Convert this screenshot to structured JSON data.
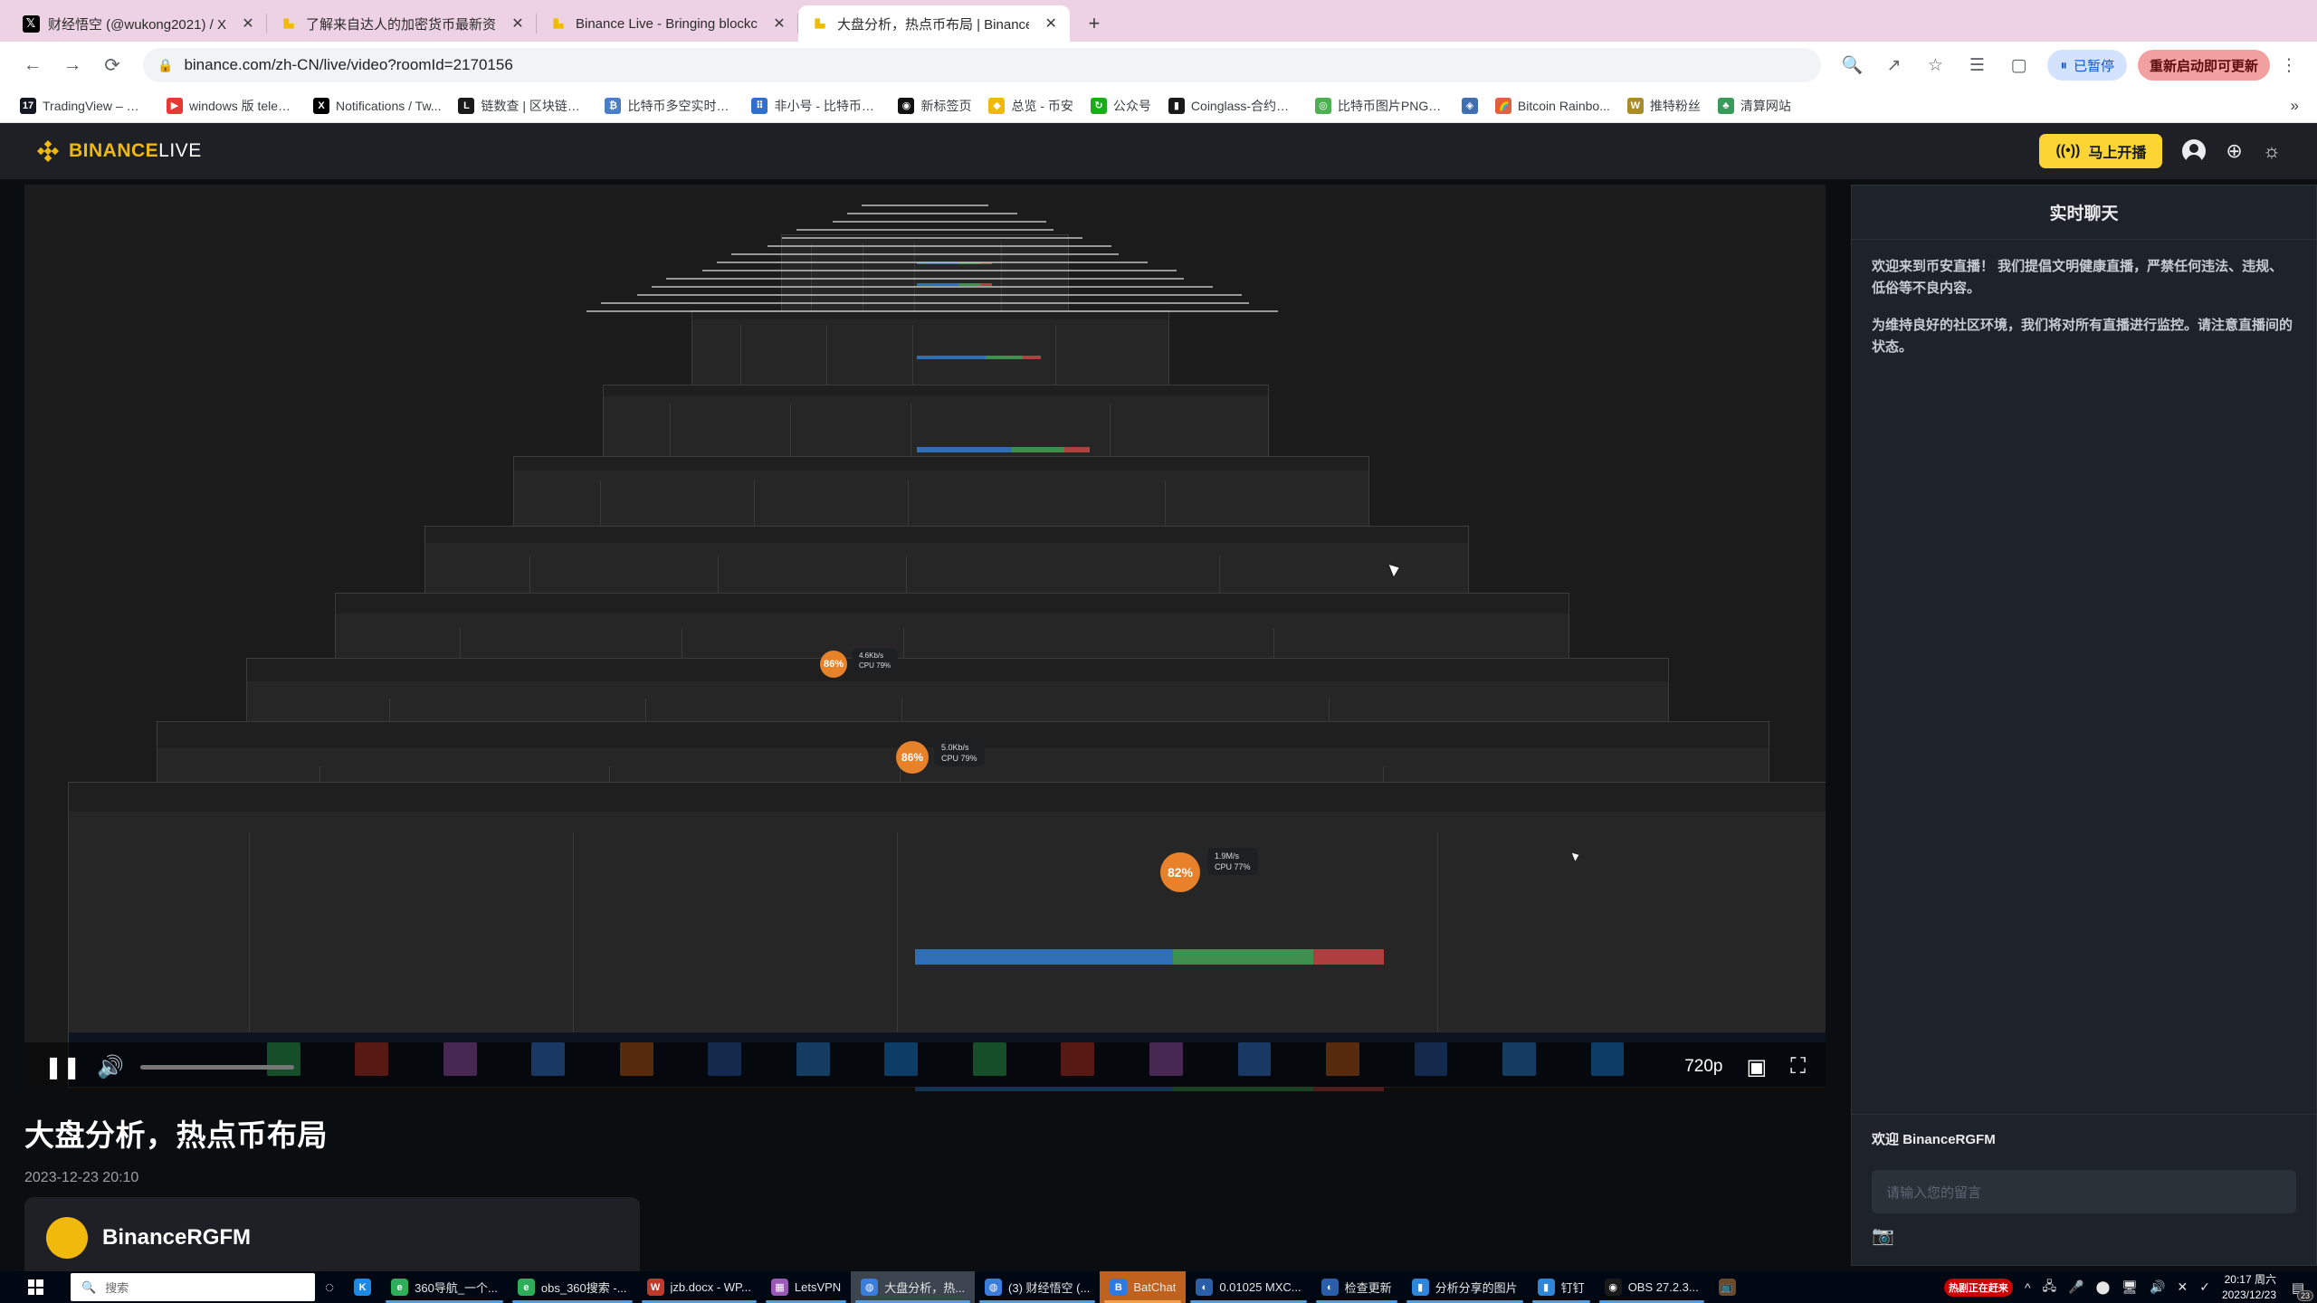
{
  "browser": {
    "tabs": [
      {
        "favicon": "x-logo-icon",
        "label": "财经悟空 (@wukong2021) / X",
        "close": "✕",
        "active": false
      },
      {
        "favicon": "binance-icon",
        "label": "了解来自达人的加密货币最新资",
        "close": "✕",
        "active": false
      },
      {
        "favicon": "binance-icon",
        "label": "Binance Live - Bringing blockc",
        "close": "✕",
        "active": false
      },
      {
        "favicon": "binance-icon",
        "label": "大盘分析，热点币布局 | Binance",
        "close": "✕",
        "active": true
      }
    ],
    "new_tab_label": "+",
    "nav": {
      "back": "←",
      "forward": "→",
      "reload": "⟳",
      "lock_icon": "lock-icon",
      "url": "binance.com/zh-CN/live/video?roomId=2170156",
      "zoom_icon": "🔍",
      "share_icon": "↗",
      "star_icon": "☆",
      "lists_icon": "☰",
      "sidepanel_icon": "▢",
      "paused_label": "已暂停",
      "update_label": "重新启动即可更新",
      "menu": "⋮"
    },
    "bookmarks": [
      {
        "icon_color": "#131722",
        "glyph": "17",
        "label": "TradingView – 追..."
      },
      {
        "icon_color": "#e53935",
        "glyph": "▶",
        "label": "windows 版 telegr..."
      },
      {
        "icon_color": "#000000",
        "glyph": "X",
        "label": "Notifications / Tw..."
      },
      {
        "icon_color": "#1a1a1a",
        "glyph": "L",
        "label": "链数查 | 区块链数..."
      },
      {
        "icon_color": "#4a7fc1",
        "glyph": "₿",
        "label": "比特币多空实时网..."
      },
      {
        "icon_color": "#2f6fd0",
        "glyph": "⠿",
        "label": "非小号 - 比特币行..."
      },
      {
        "icon_color": "#111111",
        "glyph": "◉",
        "label": "新标签页"
      },
      {
        "icon_color": "#f0b90b",
        "glyph": "◆",
        "label": "总览 - 币安"
      },
      {
        "icon_color": "#1aad19",
        "glyph": "↻",
        "label": "公众号"
      },
      {
        "icon_color": "#1a1a1a",
        "glyph": "▮",
        "label": "Coinglass-合约数..."
      },
      {
        "icon_color": "#4caf50",
        "glyph": "◎",
        "label": "比特币图片PNG去..."
      },
      {
        "icon_color": "#3f6fb0",
        "glyph": "◈",
        "label": ""
      },
      {
        "icon_color": "#e06040",
        "glyph": "🌈",
        "label": "Bitcoin Rainbo..."
      },
      {
        "icon_color": "#a98b2a",
        "glyph": "W",
        "label": "推特粉丝"
      },
      {
        "icon_color": "#3a9a5a",
        "glyph": "♣",
        "label": "清算网站"
      }
    ],
    "bookmarks_overflow": "»"
  },
  "site": {
    "logo_text_primary": "BINANCE",
    "logo_text_secondary": "LIVE",
    "go_live_label": "马上开播",
    "go_live_icon": "broadcast-icon",
    "account_icon": "account-icon",
    "grid_icon": "apps-grid-icon",
    "theme_icon": "brightness-icon"
  },
  "player": {
    "pause_icon": "pause-icon",
    "volume_icon": "volume-icon",
    "quality_label": "720p",
    "pip_icon": "picture-in-picture-icon",
    "fullscreen_icon": "fullscreen-icon",
    "overlays": [
      {
        "pct": "86%",
        "rate": "4.6Kb/s",
        "cpu": "CPU 79%"
      },
      {
        "pct": "86%",
        "rate": "5.0Kb/s",
        "cpu": "CPU 79%"
      },
      {
        "pct": "82%",
        "rate": "1.9M/s",
        "cpu": "CPU 77%"
      }
    ]
  },
  "video": {
    "title": "大盘分析，热点币布局",
    "date": "2023-12-23 20:10",
    "streamer_name": "BinanceRGFM"
  },
  "chat": {
    "header": "实时聊天",
    "system_messages": [
      "欢迎来到币安直播！ 我们提倡文明健康直播，严禁任何违法、违规、低俗等不良内容。",
      "为维持良好的社区环境，我们将对所有直播进行监控。请注意直播间的状态。"
    ],
    "welcome_prefix": "欢迎",
    "welcome_user": "BinanceRGFM",
    "input_placeholder": "请输入您的留言",
    "camera_icon": "camera-icon"
  },
  "taskbar": {
    "start_icon": "windows-start-icon",
    "search_icon": "search-icon",
    "search_placeholder": "搜索",
    "cortana_icon": "cortana-icon",
    "items": [
      {
        "icon_color": "#1e88e5",
        "glyph": "K",
        "label": "",
        "running": false,
        "state": "plain"
      },
      {
        "icon_color": "#2fae5a",
        "glyph": "e",
        "label": "360导航_一个...",
        "running": true,
        "state": "plain"
      },
      {
        "icon_color": "#2fae5a",
        "glyph": "e",
        "label": "obs_360搜索 -...",
        "running": true,
        "state": "plain"
      },
      {
        "icon_color": "#c0392b",
        "glyph": "W",
        "label": "jzb.docx - WP...",
        "running": true,
        "state": "plain"
      },
      {
        "icon_color": "#9b59b6",
        "glyph": "▦",
        "label": "LetsVPN",
        "running": true,
        "state": "plain"
      },
      {
        "icon_color": "#3b7ddd",
        "glyph": "◍",
        "label": "大盘分析，热...",
        "running": true,
        "state": "active"
      },
      {
        "icon_color": "#3b7ddd",
        "glyph": "◍",
        "label": "(3) 财经悟空 (...",
        "running": true,
        "state": "plain"
      },
      {
        "icon_color": "#2c7be5",
        "glyph": "B",
        "label": "BatChat",
        "running": true,
        "state": "orange"
      },
      {
        "icon_color": "#2b5ea8",
        "glyph": "◐",
        "label": "0.01025 MXC...",
        "running": true,
        "state": "plain"
      },
      {
        "icon_color": "#2b5ea8",
        "glyph": "◐",
        "label": "检查更新",
        "running": true,
        "state": "plain"
      },
      {
        "icon_color": "#2f86d8",
        "glyph": "▮",
        "label": "分析分享的图片",
        "running": true,
        "state": "plain"
      },
      {
        "icon_color": "#2f86d8",
        "glyph": "▮",
        "label": "钉钉",
        "running": true,
        "state": "plain"
      },
      {
        "icon_color": "#1a1a1a",
        "glyph": "◉",
        "label": "OBS 27.2.3...",
        "running": true,
        "state": "plain"
      },
      {
        "icon_color": "#6a4a2a",
        "glyph": "📺",
        "label": "",
        "running": false,
        "state": "plain"
      }
    ],
    "red_pills": [
      "热",
      "剧",
      "正",
      "在",
      "赶",
      "来"
    ],
    "tray_icons": [
      "^",
      "🖧",
      "🎤",
      "⬤",
      "🖥",
      "🔊",
      "✕",
      "✓"
    ],
    "time": "20:17 周六",
    "date": "2023/12/23",
    "notification_icon": "notification-icon",
    "notification_count": "23"
  }
}
